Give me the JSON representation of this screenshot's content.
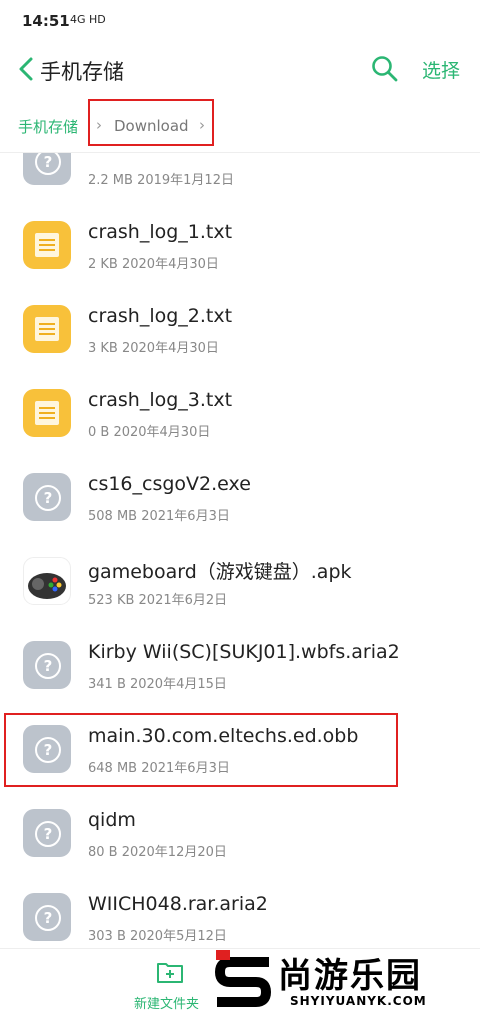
{
  "status_bar": {
    "time": "14:51",
    "signal": "4G HD"
  },
  "header": {
    "title": "手机存储",
    "select_label": "选择"
  },
  "breadcrumb": {
    "root": "手机存储",
    "current": "Download"
  },
  "files": [
    {
      "name": "",
      "meta": "2.2 MB  2019年1月12日",
      "icon": "unknown-file-icon"
    },
    {
      "name": "crash_log_1.txt",
      "meta": "2 KB  2020年4月30日",
      "icon": "text-file-icon"
    },
    {
      "name": "crash_log_2.txt",
      "meta": "3 KB  2020年4月30日",
      "icon": "text-file-icon"
    },
    {
      "name": "crash_log_3.txt",
      "meta": "0 B  2020年4月30日",
      "icon": "text-file-icon"
    },
    {
      "name": "cs16_csgoV2.exe",
      "meta": "508 MB  2021年6月3日",
      "icon": "unknown-file-icon"
    },
    {
      "name": "gameboard（游戏键盘）.apk",
      "meta": "523 KB  2021年6月2日",
      "icon": "apk-icon"
    },
    {
      "name": "Kirby Wii(SC)[SUKJ01].wbfs.aria2",
      "meta": "341 B  2020年4月15日",
      "icon": "unknown-file-icon"
    },
    {
      "name": "main.30.com.eltechs.ed.obb",
      "meta": "648 MB  2021年6月3日",
      "icon": "unknown-file-icon"
    },
    {
      "name": "qidm",
      "meta": "80 B  2020年12月20日",
      "icon": "unknown-file-icon"
    },
    {
      "name": "WIICH048.rar.aria2",
      "meta": "303 B  2020年5月12日",
      "icon": "unknown-file-icon"
    }
  ],
  "bottom_bar": {
    "new_folder_label": "新建文件夹"
  },
  "watermark": {
    "title": "尚游乐园",
    "subtitle": "SHYIYUANYK.COM"
  },
  "colors": {
    "accent": "#2bb673",
    "highlight": "#e02020",
    "txt_icon": "#f8c13a",
    "unknown_icon": "#bcc3cc"
  }
}
